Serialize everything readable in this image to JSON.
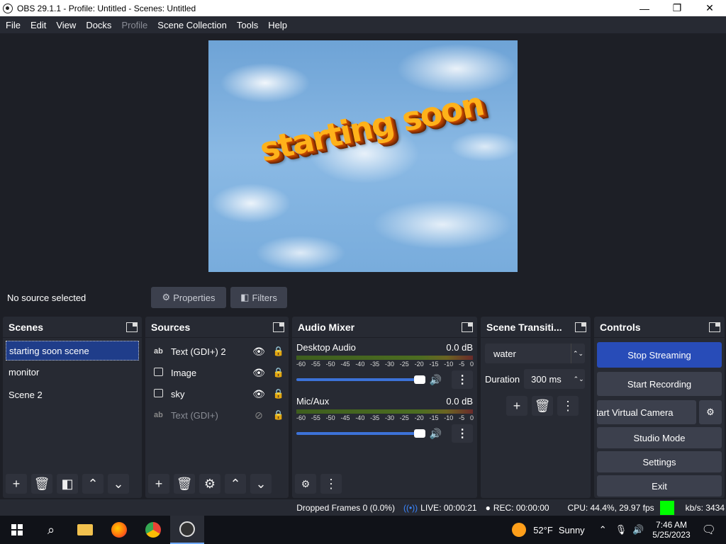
{
  "titlebar": {
    "title": "OBS 29.1.1 - Profile: Untitled - Scenes: Untitled",
    "minimize": "—",
    "maximize": "❐",
    "close": "✕"
  },
  "menu": [
    "File",
    "Edit",
    "View",
    "Docks",
    "Profile",
    "Scene Collection",
    "Tools",
    "Help"
  ],
  "preview": {
    "overlay_text": "starting soon"
  },
  "propbar": {
    "no_source": "No source selected",
    "properties": "Properties",
    "filters": "Filters"
  },
  "scenes": {
    "title": "Scenes",
    "items": [
      "starting soon scene",
      "monitor",
      "Scene 2"
    ]
  },
  "sources": {
    "title": "Sources",
    "items": [
      {
        "icon": "ab",
        "label": "Text (GDI+) 2",
        "visible": true
      },
      {
        "icon": "image",
        "label": "Image",
        "visible": true
      },
      {
        "icon": "image",
        "label": "sky",
        "visible": true
      },
      {
        "icon": "ab",
        "label": "Text (GDI+)",
        "visible": false
      }
    ]
  },
  "mixer": {
    "title": "Audio Mixer",
    "channels": [
      {
        "name": "Desktop Audio",
        "level": "0.0 dB"
      },
      {
        "name": "Mic/Aux",
        "level": "0.0 dB"
      }
    ],
    "ticks": [
      "-60",
      "-55",
      "-50",
      "-45",
      "-40",
      "-35",
      "-30",
      "-25",
      "-20",
      "-15",
      "-10",
      "-5",
      "0"
    ]
  },
  "transitions": {
    "title": "Scene Transiti...",
    "selected": "water",
    "duration_label": "Duration",
    "duration_value": "300 ms"
  },
  "controls": {
    "title": "Controls",
    "stop_streaming": "Stop Streaming",
    "start_recording": "Start Recording",
    "start_virtual_camera": "Start Virtual Camera",
    "studio_mode": "Studio Mode",
    "settings": "Settings",
    "exit": "Exit"
  },
  "status": {
    "dropped_frames": "Dropped Frames 0 (0.0%)",
    "live": "LIVE: 00:00:21",
    "rec": "REC: 00:00:00",
    "cpu": "CPU: 44.4%, 29.97 fps",
    "kbs": "kb/s: 3434"
  },
  "taskbar": {
    "temp": "52°F",
    "weather": "Sunny",
    "time": "7:46 AM",
    "date": "5/25/2023"
  },
  "colors": {
    "accent": "#284cb8",
    "status_green": "#00ff00",
    "overlay_orange": "#ffb21a"
  }
}
